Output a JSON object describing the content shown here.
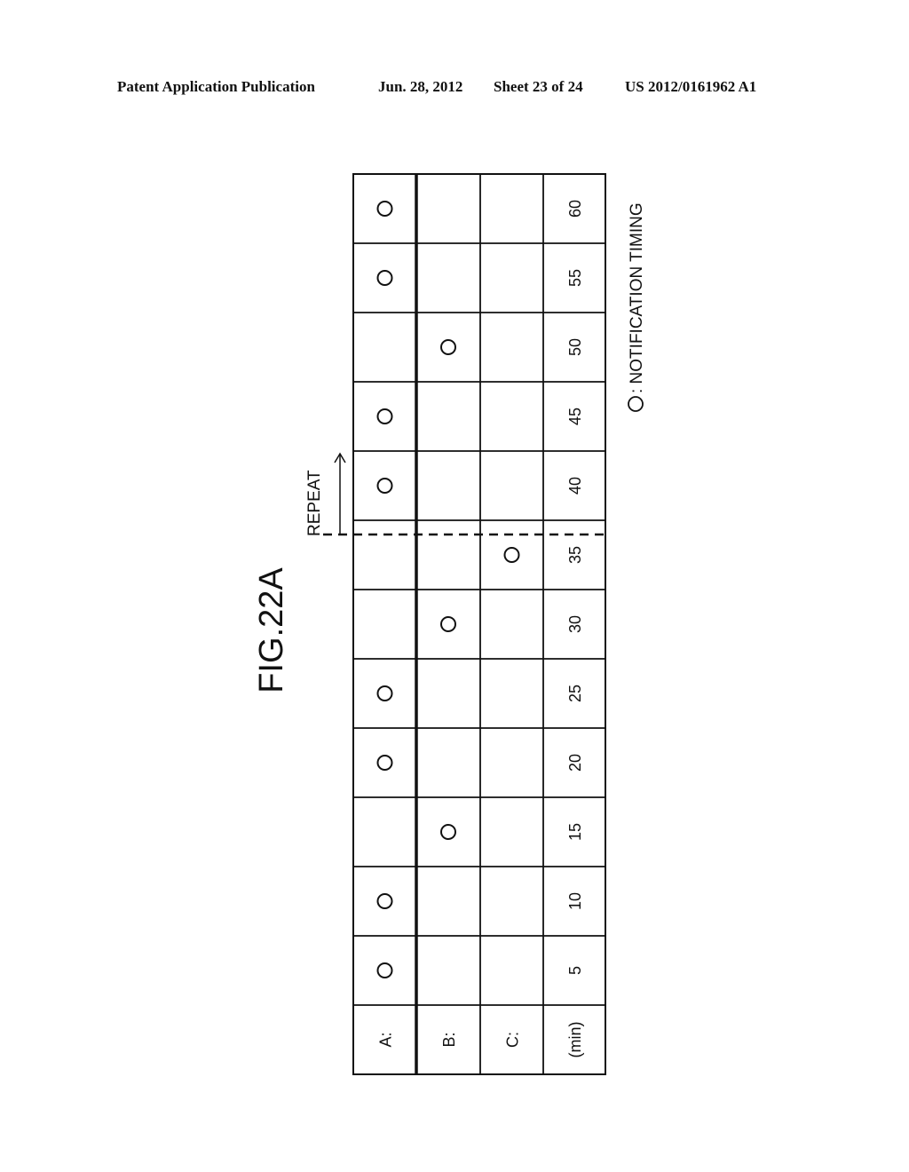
{
  "header": {
    "publication": "Patent Application Publication",
    "date": "Jun. 28, 2012",
    "sheet": "Sheet 23 of 24",
    "number": "US 2012/0161962 A1"
  },
  "figure": {
    "title": "FIG.22A",
    "legend_symbol": "○",
    "legend": "○: NOTIFICATION TIMING",
    "legend_text": ": NOTIFICATION TIMING",
    "repeat_label": "REPEAT",
    "repeat_after_min": 35
  },
  "table": {
    "row_labels": [
      "A:",
      "B:",
      "C:",
      "(min)"
    ],
    "times": [
      "5",
      "10",
      "15",
      "20",
      "25",
      "30",
      "35",
      "40",
      "45",
      "50",
      "55",
      "60"
    ],
    "marks": {
      "A": [
        5,
        10,
        20,
        25,
        40,
        45,
        55,
        60
      ],
      "B": [
        15,
        30,
        50
      ],
      "C": [
        35
      ]
    }
  }
}
